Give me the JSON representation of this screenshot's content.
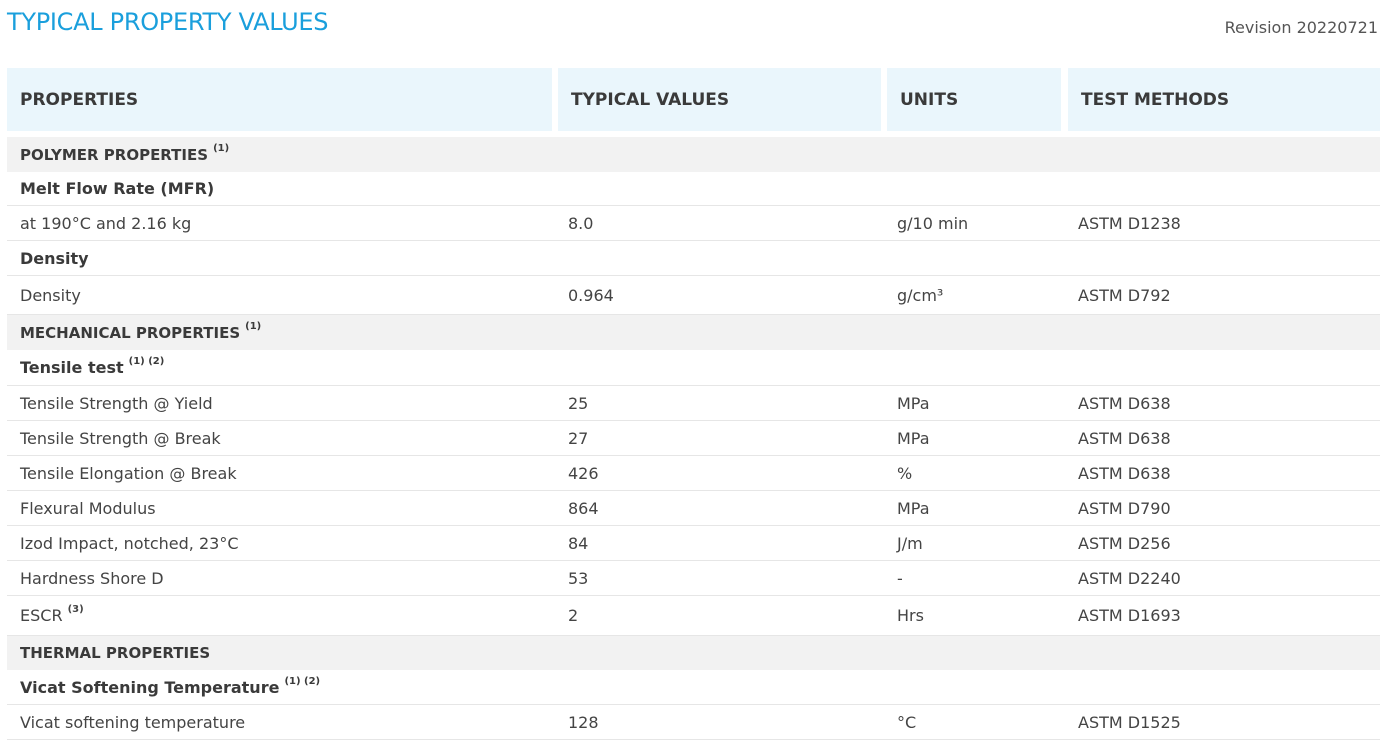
{
  "title": "TYPICAL PROPERTY VALUES",
  "revision": "Revision 20220721",
  "columns": {
    "properties": "PROPERTIES",
    "typical_values": "TYPICAL VALUES",
    "units": "UNITS",
    "test_methods": "TEST METHODS"
  },
  "rows": [
    {
      "kind": "section",
      "label": "POLYMER PROPERTIES",
      "note": "(1)"
    },
    {
      "kind": "group",
      "label": "Melt Flow Rate (MFR)"
    },
    {
      "kind": "data",
      "label": "at 190°C and 2.16 kg",
      "value": "8.0",
      "unit": "g/10 min",
      "method": "ASTM D1238"
    },
    {
      "kind": "group",
      "label": "Density"
    },
    {
      "kind": "data",
      "label": "Density",
      "value": "0.964",
      "unit": "g/cm³",
      "method": "ASTM D792"
    },
    {
      "kind": "section",
      "label": "MECHANICAL PROPERTIES",
      "note": "(1)"
    },
    {
      "kind": "group",
      "label": "Tensile test",
      "note": "(1) (2)"
    },
    {
      "kind": "data",
      "label": "Tensile Strength @ Yield",
      "value": "25",
      "unit": "MPa",
      "method": "ASTM D638"
    },
    {
      "kind": "data",
      "label": "Tensile Strength @ Break",
      "value": "27",
      "unit": "MPa",
      "method": "ASTM D638"
    },
    {
      "kind": "data",
      "label": "Tensile Elongation @ Break",
      "value": "426",
      "unit": "%",
      "method": "ASTM D638"
    },
    {
      "kind": "data",
      "label": "Flexural Modulus",
      "value": "864",
      "unit": "MPa",
      "method": "ASTM D790"
    },
    {
      "kind": "data",
      "label": "Izod Impact, notched, 23°C",
      "value": "84",
      "unit": "J/m",
      "method": "ASTM D256"
    },
    {
      "kind": "data",
      "label": "Hardness Shore D",
      "value": "53",
      "unit": "-",
      "method": "ASTM D2240"
    },
    {
      "kind": "data",
      "label": "ESCR",
      "note": "(3)",
      "value": "2",
      "unit": "Hrs",
      "method": "ASTM D1693"
    },
    {
      "kind": "section",
      "label": "THERMAL PROPERTIES"
    },
    {
      "kind": "group",
      "label": "Vicat Softening Temperature",
      "note": "(1) (2)"
    },
    {
      "kind": "data",
      "label": "Vicat softening temperature",
      "value": "128",
      "unit": "°C",
      "method": "ASTM D1525"
    }
  ]
}
